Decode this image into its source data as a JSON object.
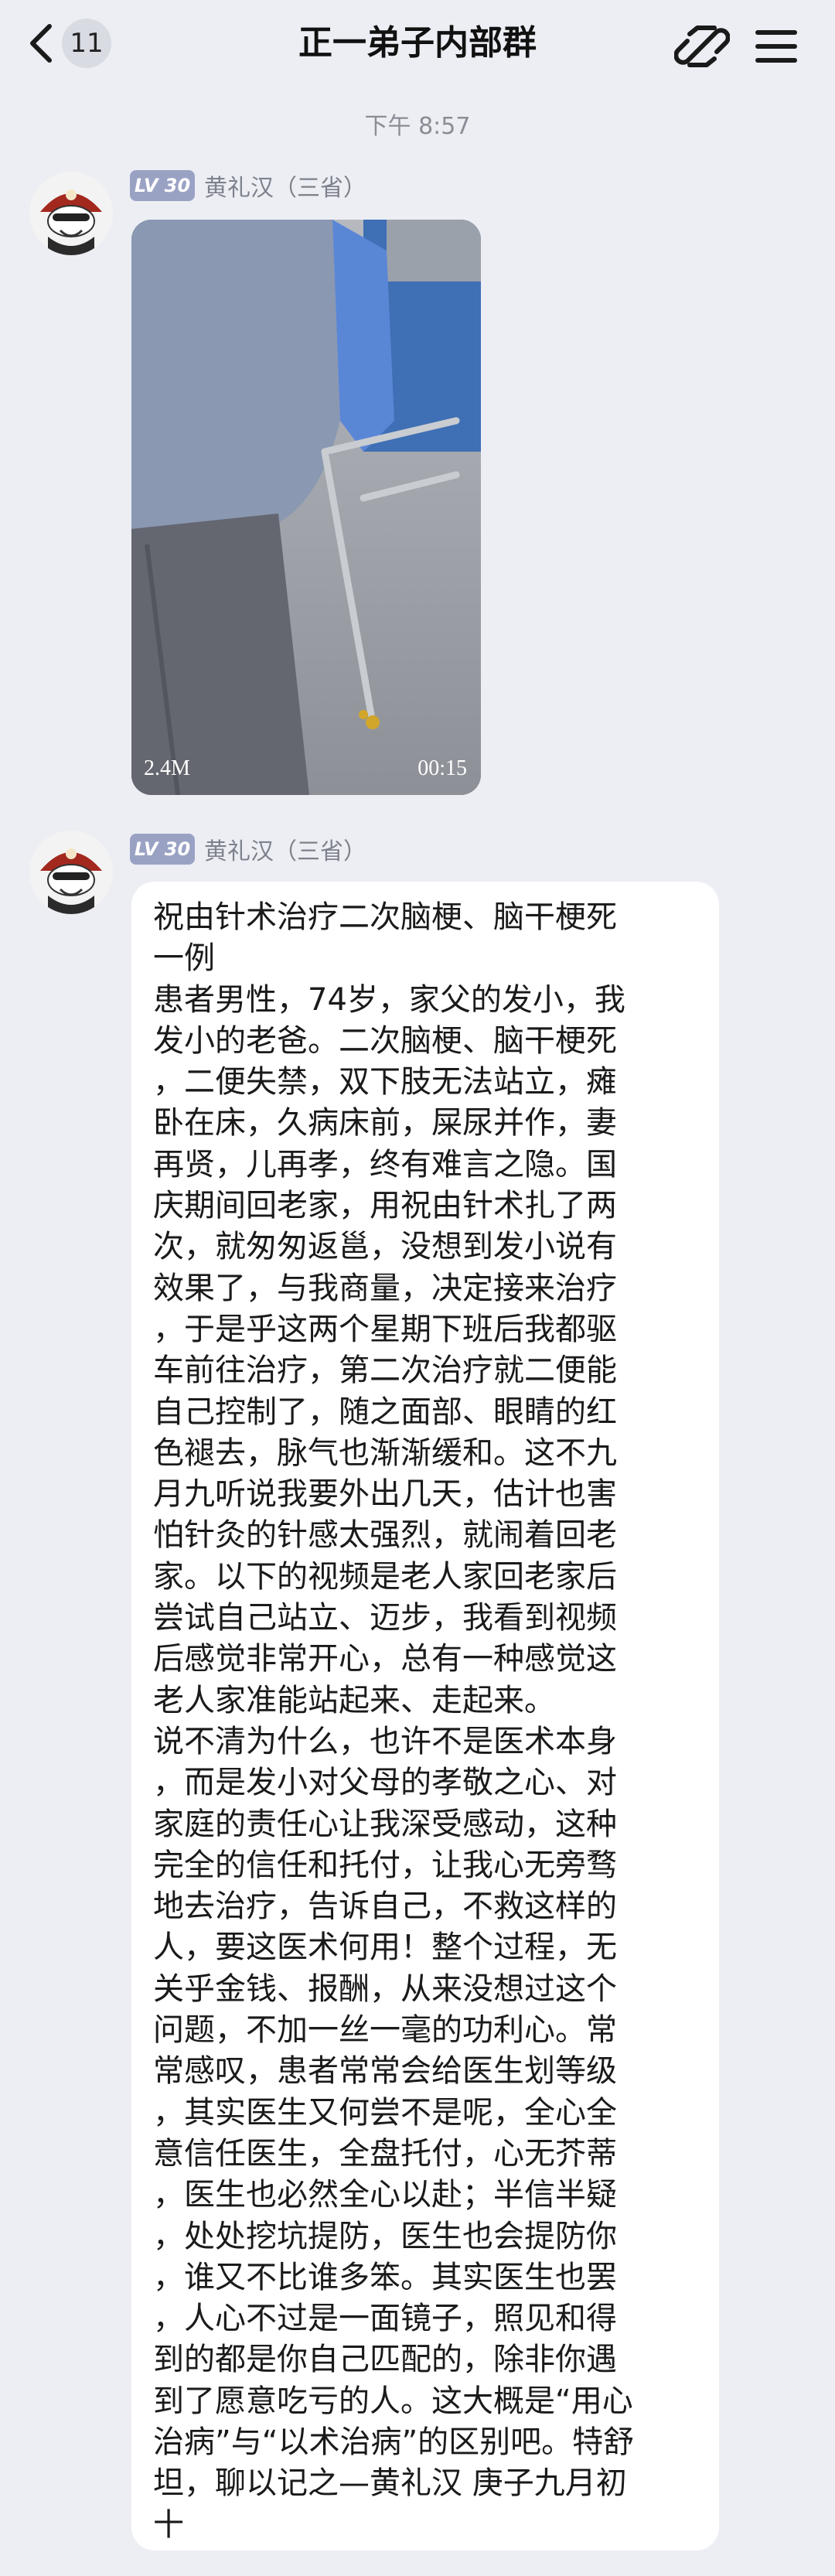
{
  "header": {
    "title": "正一弟子内部群",
    "unread_count": "11",
    "icons": [
      "back-chevron-icon",
      "link-icon",
      "menu-icon"
    ]
  },
  "timestamp": "下午 8:57",
  "messages": [
    {
      "level": "LV 30",
      "sender": "黄礼汉（三省）",
      "video": {
        "size": "2.4M",
        "duration": "00:15"
      }
    },
    {
      "level": "LV 30",
      "sender": "黄礼汉（三省）",
      "lines": [
        "祝由针术治疗二次脑梗、脑干梗死",
        "一例",
        "患者男性，74岁，家父的发小，我",
        "发小的老爸。二次脑梗、脑干梗死",
        "，二便失禁，双下肢无法站立，瘫",
        "卧在床，久病床前，屎尿并作，妻",
        "再贤，儿再孝，终有难言之隐。国",
        "庆期间回老家，用祝由针术扎了两",
        "次，就匆匆返邕，没想到发小说有",
        "效果了，与我商量，决定接来治疗",
        "，于是乎这两个星期下班后我都驱",
        "车前往治疗，第二次治疗就二便能",
        "自己控制了，随之面部、眼睛的红",
        "色褪去，脉气也渐渐缓和。这不九",
        "月九听说我要外出几天，估计也害",
        "怕针灸的针感太强烈，就闹着回老",
        "家。以下的视频是老人家回老家后",
        "尝试自己站立、迈步，我看到视频",
        "后感觉非常开心，总有一种感觉这",
        "老人家准能站起来、走起来。",
        "说不清为什么，也许不是医术本身",
        "，而是发小对父母的孝敬之心、对",
        "家庭的责任心让我深受感动，这种",
        "完全的信任和托付，让我心无旁骛",
        "地去治疗，告诉自己，不救这样的",
        "人，要这医术何用！整个过程，无",
        "关乎金钱、报酬，从来没想过这个",
        "问题，不加一丝一毫的功利心。常",
        "常感叹，患者常常会给医生划等级",
        "，其实医生又何尝不是呢，全心全",
        "意信任医生，全盘托付，心无芥蒂",
        "，医生也必然全心以赴；半信半疑",
        "，处处挖坑提防，医生也会提防你",
        "，谁又不比谁多笨。其实医生也罢",
        "，人心不过是一面镜子，照见和得",
        "到的都是你自己匹配的，除非你遇",
        "到了愿意吃亏的人。这大概是“用心",
        "治病”与“以术治病”的区别吧。特舒",
        "坦，聊以记之—黄礼汉 庚子九月初",
        "十"
      ]
    }
  ],
  "colors": {
    "background": "#eceef4",
    "bubble": "#ffffff",
    "level_badge": "#9aa2c4"
  }
}
